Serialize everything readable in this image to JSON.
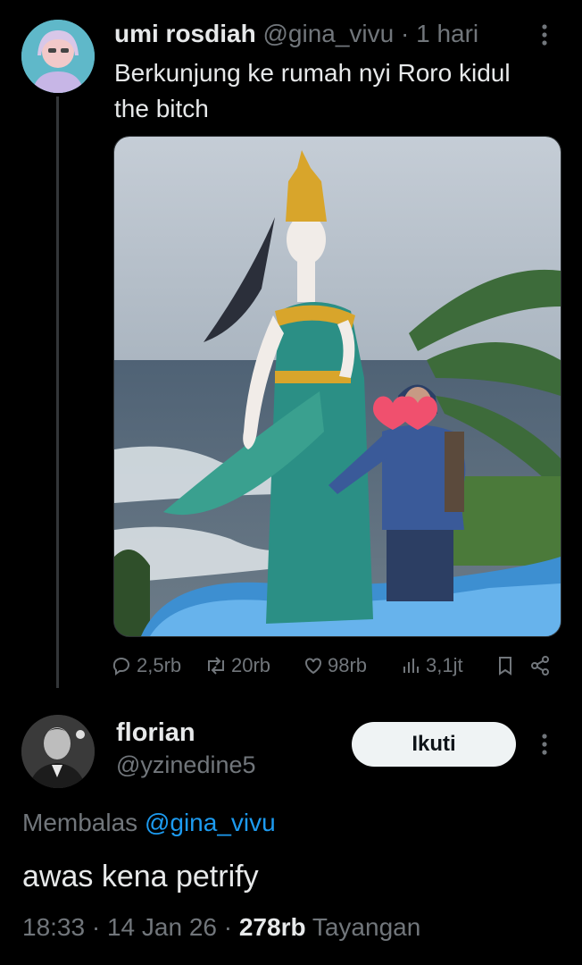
{
  "tweet": {
    "author_name": "umi rosdiah",
    "handle": "@gina_vivu",
    "separator": "·",
    "time": "1 hari",
    "text_line1": "Berkunjung ke rumah nyi Roro kidul",
    "text_line2": "the bitch",
    "stats": {
      "replies": "2,5rb",
      "reposts": "20rb",
      "likes": "98rb",
      "views": "3,1jt"
    },
    "icons": [
      "reply-icon",
      "repost-icon",
      "like-icon",
      "views-icon",
      "bookmark-icon",
      "share-icon",
      "more-icon"
    ]
  },
  "reply": {
    "author_name": "florian",
    "handle": "@yzinedine5",
    "follow_label": "Ikuti",
    "replying_prefix": "Membalas",
    "replying_mention": "@gina_vivu",
    "text": "awas kena petrify",
    "time": "18:33",
    "date": "14 Jan 26",
    "views_count": "278rb",
    "views_label": "Tayangan",
    "separator": "·"
  },
  "colors": {
    "background": "#000000",
    "text": "#e7e9ea",
    "muted": "#71767b",
    "link": "#1d9bf0",
    "button_bg": "#eff3f4"
  }
}
